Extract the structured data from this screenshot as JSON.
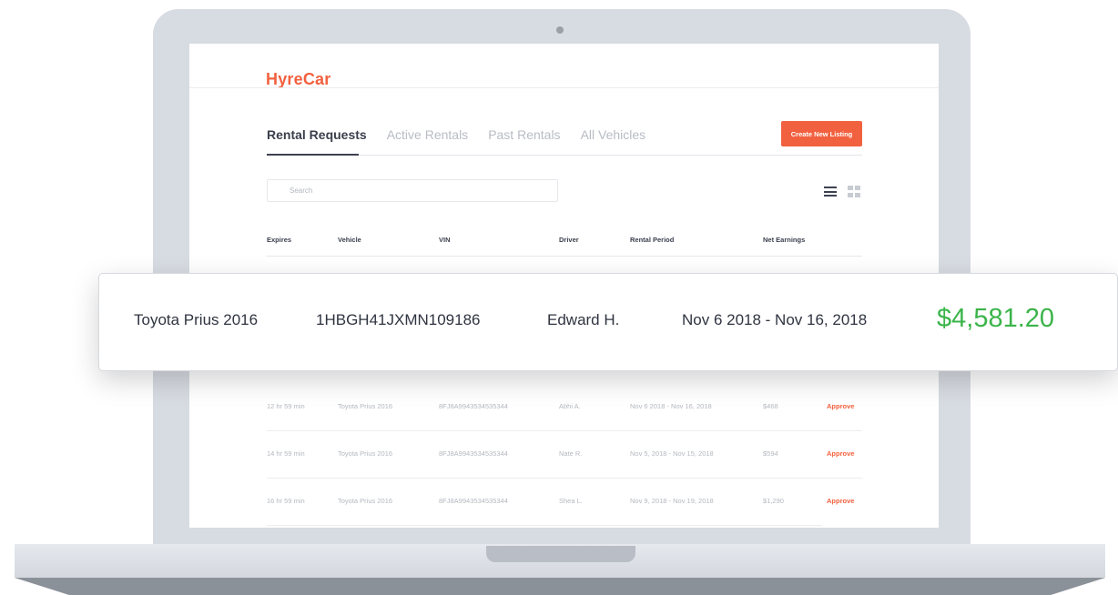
{
  "app": {
    "logo": "HyreCar"
  },
  "tabs": [
    {
      "label": "Rental Requests",
      "active": true
    },
    {
      "label": "Active Rentals",
      "active": false
    },
    {
      "label": "Past Rentals",
      "active": false
    },
    {
      "label": "All Vehicles",
      "active": false
    }
  ],
  "toolbar": {
    "create_label": "Create New Listing"
  },
  "search": {
    "placeholder": "Search"
  },
  "views": {
    "list_icon": "list-view-icon",
    "grid_icon": "grid-view-icon"
  },
  "table": {
    "headers": [
      "Expires",
      "Vehicle",
      "VIN",
      "Driver",
      "Rental Period",
      "Net Earnings"
    ],
    "rows": [
      {
        "expires": "12 hr 59 min",
        "vehicle": "Toyota Prius 2016",
        "vin": "8FJ8A9943534535344",
        "driver": "Abhi A.",
        "period": "Nov 6 2018  - Nov 16, 2018",
        "earnings": "$468",
        "action": "Approve"
      },
      {
        "expires": "14 hr 59 min",
        "vehicle": "Toyota Prius 2016",
        "vin": "8FJ8A9943534535344",
        "driver": "Nate R.",
        "period": "Nov 5, 2018  - Nov 15, 2018",
        "earnings": "$594",
        "action": "Approve"
      },
      {
        "expires": "16 hr 59 min",
        "vehicle": "Toyota Prius 2016",
        "vin": "8FJ8A9943534535344",
        "driver": "Shea L.",
        "period": "Nov 9, 2018  - Nov 19, 2018",
        "earnings": "$1,290",
        "action": "Approve"
      }
    ]
  },
  "highlight": {
    "vehicle": "Toyota Prius 2016",
    "vin": "1HBGH41JXMN109186",
    "driver": "Edward H.",
    "period": "Nov 6 2018  - Nov 16, 2018",
    "earnings": "$4,581.20"
  },
  "colors": {
    "accent": "#f2613f",
    "earnings": "#3bb44a",
    "text": "#3a3f4c",
    "muted": "#b8bcc4"
  }
}
